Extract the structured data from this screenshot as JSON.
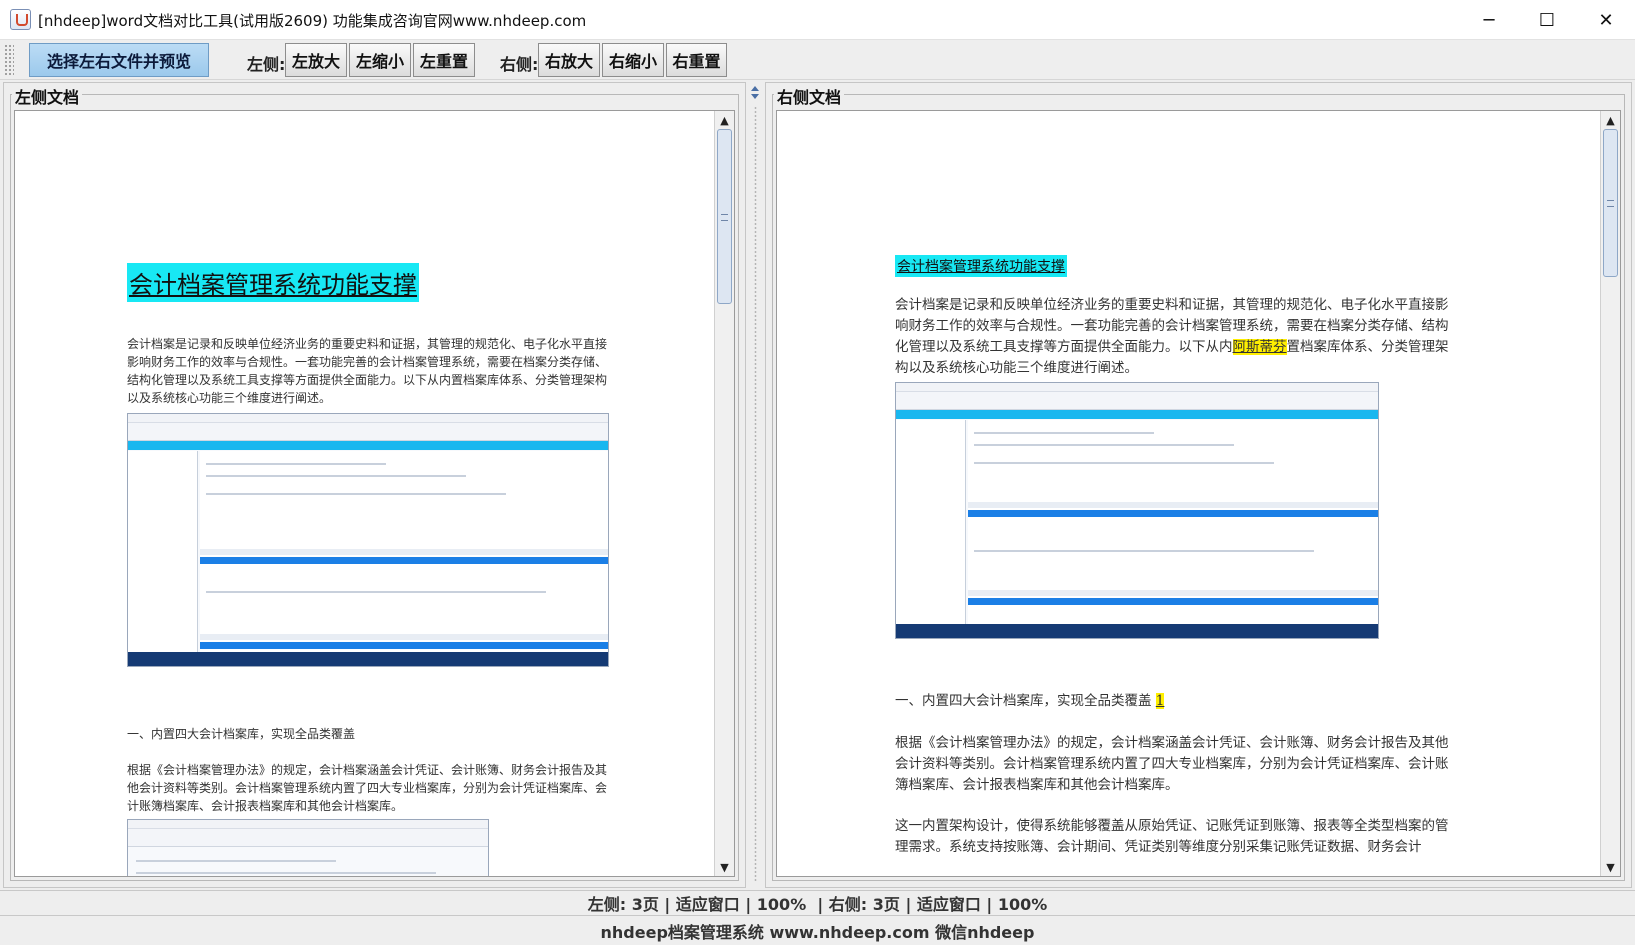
{
  "window": {
    "title": "[nhdeep]word文档对比工具(试用版2609) 功能集成咨询官网www.nhdeep.com",
    "controls": {
      "minimize": "─",
      "maximize": "☐",
      "close": "✕"
    }
  },
  "toolbar": {
    "select_button": "选择左右文件并预览",
    "left_label": "左侧:",
    "left_zoom_in": "左放大",
    "left_zoom_out": "左缩小",
    "left_reset": "左重置",
    "right_label": "右侧:",
    "right_zoom_in": "右放大",
    "right_zoom_out": "右缩小",
    "right_reset": "右重置"
  },
  "left_panel": {
    "title": "左侧文档",
    "heading": "会计档案管理系统功能支撑",
    "paragraph1": "会计档案是记录和反映单位经济业务的重要史料和证据，其管理的规范化、电子化水平直接影响财务工作的效率与合规性。一套功能完善的会计档案管理系统，需要在档案分类存储、结构化管理以及系统工具支撑等方面提供全面能力。以下从内置档案库体系、分类管理架构以及系统核心功能三个维度进行阐述。",
    "section1": "一、内置四大会计档案库，实现全品类覆盖",
    "paragraph2": "根据《会计档案管理办法》的规定，会计档案涵盖会计凭证、会计账簿、财务会计报告及其他会计资料等类别。会计档案管理系统内置了四大专业档案库，分别为会计凭证档案库、会计账簿档案库、会计报表档案库和其他会计档案库。"
  },
  "right_panel": {
    "title": "右侧文档",
    "heading": "会计档案管理系统功能支撑",
    "paragraph1_part1": "会计档案是记录和反映单位经济业务的重要史料和证据，其管理的规范化、电子化水平直接影响财务工作的效率与合规性。一套功能完善的会计档案管理系统，需要在档案分类存储、结构化管理以及系统工具支撑等方面提供全面能力。以下从内",
    "paragraph1_highlight": "阿斯蒂芬",
    "paragraph1_part2": "置档案库体系、分类管理架构以及系统核心功能三个维度进行阐述。",
    "section1": "一、内置四大会计档案库，实现全品类覆盖",
    "section1_highlight": "1",
    "paragraph2": "根据《会计档案管理办法》的规定，会计档案涵盖会计凭证、会计账簿、财务会计报告及其他会计资料等类别。会计档案管理系统内置了四大专业档案库，分别为会计凭证档案库、会计账簿档案库、会计报表档案库和其他会计档案库。",
    "paragraph3": "这一内置架构设计，使得系统能够覆盖从原始凭证、记账凭证到账簿、报表等全类型档案的管理需求。系统支持按账簿、会计期间、凭证类别等维度分别采集记账凭证数据、财务会计"
  },
  "status": {
    "text": "左侧: 3页 | 适应窗口 | 100%  | 右侧: 3页 | 适应窗口 | 100%"
  },
  "footer": {
    "text": "nhdeep档案管理系统 www.nhdeep.com 微信nhdeep"
  },
  "colors": {
    "heading_highlight": "#18e8f4",
    "change_highlight": "#ffef00",
    "primary_button": "#9cc9ec"
  }
}
